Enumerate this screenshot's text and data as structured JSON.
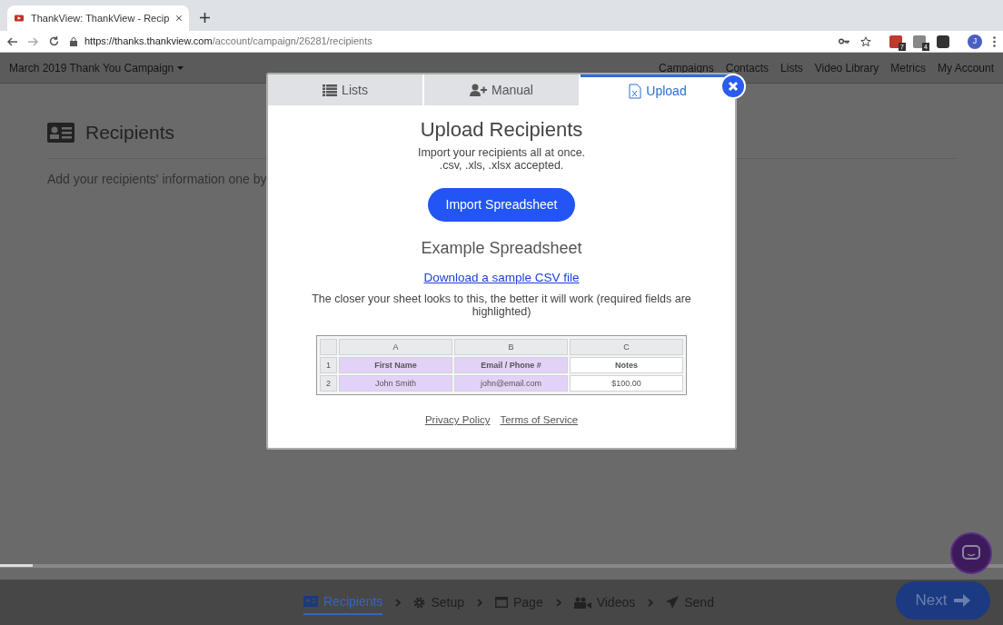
{
  "browser": {
    "tab_title": "ThankView: ThankView - Recip",
    "url_host": "https://thanks.thankview.com",
    "url_path": "/account/campaign/26281/recipients",
    "extension_badges": [
      "7",
      "4"
    ],
    "profile_initial": "J"
  },
  "app_nav": {
    "campaign": "March 2019 Thank You Campaign",
    "links": [
      "Campaigns",
      "Contacts",
      "Lists",
      "Video Library",
      "Metrics",
      "My Account"
    ]
  },
  "page": {
    "heading": "Recipients",
    "description": "Add your recipients' information one by"
  },
  "modal": {
    "tabs": [
      {
        "label": "Lists",
        "selected": false
      },
      {
        "label": "Manual",
        "selected": false
      },
      {
        "label": "Upload",
        "selected": true
      }
    ],
    "title": "Upload Recipients",
    "subtitle": [
      "Import your recipients all at once.",
      ".csv, .xls, .xlsx accepted."
    ],
    "import_button": "Import Spreadsheet",
    "example_heading": "Example Spreadsheet",
    "sample_link": "Download a sample CSV file",
    "note": "The closer your sheet looks to this, the better it will work (required fields are highlighted)",
    "spreadsheet": {
      "columns": [
        "A",
        "B",
        "C"
      ],
      "rows": [
        {
          "number": "1",
          "cells": [
            {
              "text": "First Name",
              "highlighted": true
            },
            {
              "text": "Email / Phone #",
              "highlighted": true
            },
            {
              "text": "Notes",
              "highlighted": false
            }
          ]
        },
        {
          "number": "2",
          "cells": [
            {
              "text": "John Smith",
              "highlighted": true
            },
            {
              "text": "john@email.com",
              "highlighted": true
            },
            {
              "text": "$100.00",
              "highlighted": false
            }
          ]
        }
      ]
    },
    "footer_links": [
      "Privacy Policy",
      "Terms of Service"
    ]
  },
  "progress": {
    "level": 0.033
  },
  "steps": [
    {
      "label": "Recipients",
      "selected": true
    },
    {
      "label": "Setup",
      "selected": false
    },
    {
      "label": "Page",
      "selected": false
    },
    {
      "label": "Videos",
      "selected": false
    },
    {
      "label": "Send",
      "selected": false
    }
  ],
  "next_button": "Next"
}
